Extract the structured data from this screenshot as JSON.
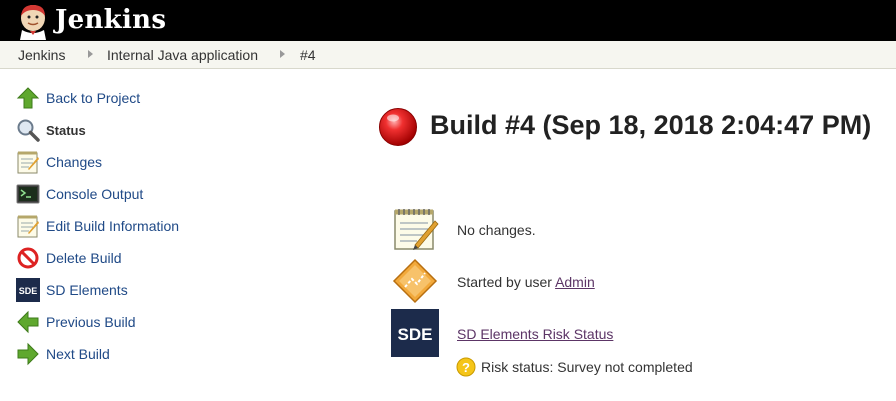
{
  "header": {
    "title": "Jenkins"
  },
  "breadcrumb": {
    "items": [
      "Jenkins",
      "Internal Java application",
      "#4"
    ]
  },
  "sidebar": {
    "items": [
      {
        "label": "Back to Project",
        "icon": "up-arrow-icon"
      },
      {
        "label": "Status",
        "icon": "magnifier-icon",
        "active": true
      },
      {
        "label": "Changes",
        "icon": "notepad-icon"
      },
      {
        "label": "Console Output",
        "icon": "terminal-icon"
      },
      {
        "label": "Edit Build Information",
        "icon": "notepad-icon"
      },
      {
        "label": "Delete Build",
        "icon": "no-entry-icon"
      },
      {
        "label": "SD Elements",
        "icon": "sde-icon"
      },
      {
        "label": "Previous Build",
        "icon": "left-arrow-icon"
      },
      {
        "label": "Next Build",
        "icon": "right-arrow-icon"
      }
    ]
  },
  "main": {
    "build_title": "Build #4 (Sep 18, 2018 2:04:47 PM)",
    "status_color": "#e02020",
    "changes_text": "No changes.",
    "started_by_prefix": "Started by user ",
    "started_by_user": "Admin",
    "sde_link": "SD Elements Risk Status",
    "risk_status": "Risk status: Survey not completed"
  },
  "colors": {
    "header_bg": "#000000",
    "breadcrumb_bg": "#f6f6f0",
    "link": "#204a87",
    "visited_link": "#5c3566",
    "sde_brand": "#1c2b4b"
  }
}
